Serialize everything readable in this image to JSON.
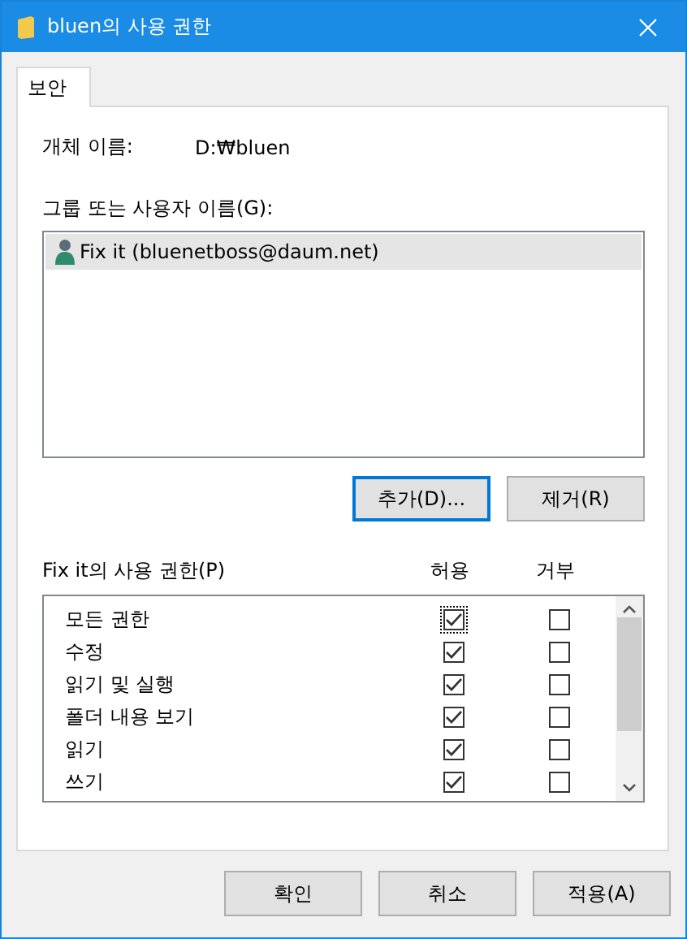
{
  "window": {
    "title": "bluen의 사용 권한"
  },
  "tabs": [
    {
      "label": "보안",
      "selected": true
    }
  ],
  "object_name": {
    "label": "개체 이름:",
    "value": "D:₩bluen"
  },
  "groups": {
    "label": "그룹 또는 사용자 이름(G):",
    "items": [
      {
        "name": "Fix it (bluenetboss@daum.net)",
        "selected": true
      }
    ]
  },
  "group_buttons": [
    {
      "label": "추가(D)...",
      "focused": true
    },
    {
      "label": "제거(R)",
      "focused": false
    }
  ],
  "permissions": {
    "label": "Fix it의 사용 권한(P)",
    "columns": [
      "허용",
      "거부"
    ],
    "rows": [
      {
        "name": "모든 권한",
        "allow": true,
        "deny": false,
        "focused": true
      },
      {
        "name": "수정",
        "allow": true,
        "deny": false,
        "focused": false
      },
      {
        "name": "읽기 및 실행",
        "allow": true,
        "deny": false,
        "focused": false
      },
      {
        "name": "폴더 내용 보기",
        "allow": true,
        "deny": false,
        "focused": false
      },
      {
        "name": "읽기",
        "allow": true,
        "deny": false,
        "focused": false
      },
      {
        "name": "쓰기",
        "allow": true,
        "deny": false,
        "focused": false
      }
    ]
  },
  "buttons": [
    "확인",
    "취소",
    "적용(A)"
  ]
}
